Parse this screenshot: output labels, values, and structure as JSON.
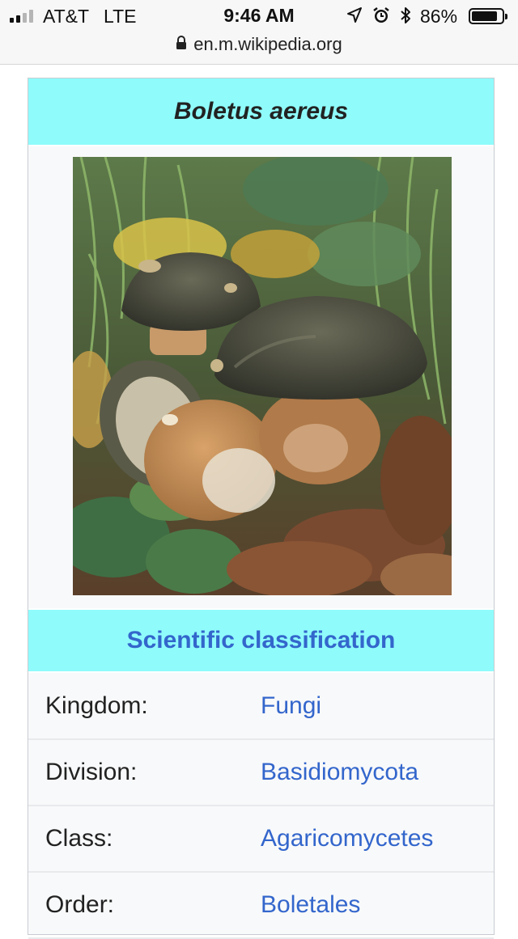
{
  "status_bar": {
    "carrier": "AT&T",
    "network": "LTE",
    "time": "9:46 AM",
    "battery_percent": "86%",
    "battery_level": 0.86,
    "signal_bars_filled": 2,
    "signal_bars_total": 4,
    "icons": [
      "location-arrow-icon",
      "alarm-icon",
      "bluetooth-icon"
    ]
  },
  "address_bar": {
    "url": "en.m.wikipedia.org",
    "icon": "lock-icon"
  },
  "infobox": {
    "title": "Boletus aereus",
    "image_icon": "mushroom-photo",
    "section_heading": "Scientific classification",
    "rows": [
      {
        "label": "Kingdom:",
        "value": "Fungi"
      },
      {
        "label": "Division:",
        "value": "Basidiomycota"
      },
      {
        "label": "Class:",
        "value": "Agaricomycetes"
      },
      {
        "label": "Order:",
        "value": "Boletales"
      }
    ]
  },
  "colors": {
    "header_bg": "#8ffbfb",
    "link": "#3366cc",
    "infobox_bg": "#f8f9fa"
  }
}
